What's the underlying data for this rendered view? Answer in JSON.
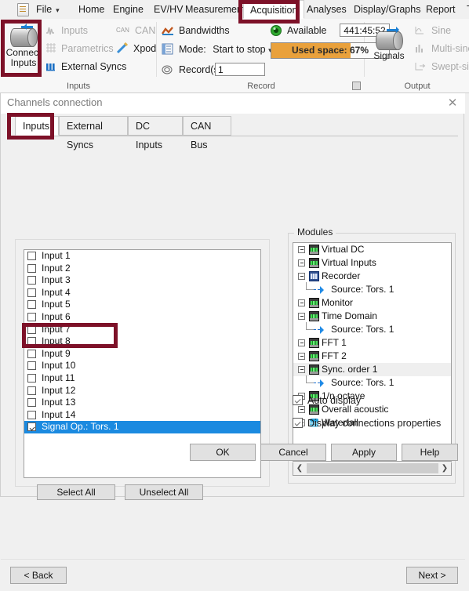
{
  "ribbon": {
    "tabs": [
      {
        "label": "File",
        "caret": true,
        "active": false
      },
      {
        "label": "Home",
        "active": false
      },
      {
        "label": "Engine",
        "active": false
      },
      {
        "label": "EV/HV",
        "active": false
      },
      {
        "label": "Measurement",
        "active": false
      },
      {
        "label": "Acquisition",
        "active": true
      },
      {
        "label": "Analyses",
        "active": false
      },
      {
        "label": "Display/Graphs",
        "active": false
      },
      {
        "label": "Report",
        "active": false
      },
      {
        "label": "T",
        "active": false
      }
    ],
    "groups": {
      "inputs": {
        "label": "Inputs",
        "big_button": {
          "line1": "Connect",
          "line2": "Inputs"
        },
        "items": [
          {
            "label": "Inputs",
            "icon": "waveform-icon",
            "disabled": true
          },
          {
            "label": "Parametrics",
            "icon": "parametrics-icon",
            "disabled": true
          },
          {
            "label": "External Syncs",
            "icon": "sync-icon",
            "disabled": false
          },
          {
            "label": "CAN",
            "icon": "can-icon",
            "disabled": true
          },
          {
            "label": "Xpod",
            "icon": "xpod-icon",
            "disabled": false
          }
        ]
      },
      "record": {
        "label": "Record",
        "bandwidths": "Bandwidths",
        "mode_label": "Mode:",
        "mode_value": "Start to stop",
        "records_label": "Record(s)",
        "records_value": "1",
        "available_label": "Available",
        "available_value": "441:45:52",
        "used_space_text": "Used space: 67%",
        "used_space_percent": 67,
        "used_space_color": "#e9a13c"
      },
      "output": {
        "label": "Output",
        "big_button": {
          "line1": "Signals",
          "line2": ""
        },
        "items": [
          {
            "label": "Sine",
            "icon": "sine-icon",
            "disabled": true
          },
          {
            "label": "Multi-sine",
            "icon": "multi-sine-icon",
            "disabled": true
          },
          {
            "label": "Swept-sine",
            "icon": "swept-sine-icon",
            "disabled": true
          }
        ]
      }
    }
  },
  "dialog": {
    "title": "Channels connection",
    "close_icon": "✕",
    "tabs": [
      {
        "label": "Inputs",
        "active": true
      },
      {
        "label": "External Syncs",
        "active": false
      },
      {
        "label": "DC Inputs",
        "active": false
      },
      {
        "label": "CAN Bus",
        "active": false
      }
    ],
    "channels": [
      {
        "label": "Input 1",
        "checked": false,
        "selected": false
      },
      {
        "label": "Input 2",
        "checked": false,
        "selected": false
      },
      {
        "label": "Input 3",
        "checked": false,
        "selected": false
      },
      {
        "label": "Input 4",
        "checked": false,
        "selected": false
      },
      {
        "label": "Input 5",
        "checked": false,
        "selected": false
      },
      {
        "label": "Input 6",
        "checked": false,
        "selected": false
      },
      {
        "label": "Input 7",
        "checked": false,
        "selected": false
      },
      {
        "label": "Input 8",
        "checked": false,
        "selected": false
      },
      {
        "label": "Input 9",
        "checked": false,
        "selected": false
      },
      {
        "label": "Input 10",
        "checked": false,
        "selected": false
      },
      {
        "label": "Input 11",
        "checked": false,
        "selected": false
      },
      {
        "label": "Input 12",
        "checked": false,
        "selected": false
      },
      {
        "label": "Input 13",
        "checked": false,
        "selected": false
      },
      {
        "label": "Input 14",
        "checked": false,
        "selected": false
      },
      {
        "label": "Signal Op.: Tors. 1",
        "checked": true,
        "selected": true
      }
    ],
    "selection_color": "#1b8ae0",
    "select_all": "Select All",
    "unselect_all": "Unselect All",
    "modules_legend": "Modules",
    "modules": [
      {
        "label": "Virtual DC",
        "icon": "scope-module-icon",
        "indent": 0,
        "expander": true,
        "highlight": false
      },
      {
        "label": "Virtual Inputs",
        "icon": "scope-module-icon",
        "indent": 0,
        "expander": true,
        "highlight": false
      },
      {
        "label": "Recorder",
        "icon": "recorder-module-icon",
        "indent": 0,
        "expander": true,
        "highlight": false
      },
      {
        "label": "Source: Tors. 1",
        "icon": "source-arrow-icon",
        "indent": 1,
        "expander": false,
        "highlight": false
      },
      {
        "label": "Monitor",
        "icon": "scope-module-icon",
        "indent": 0,
        "expander": true,
        "highlight": false
      },
      {
        "label": "Time Domain",
        "icon": "scope-module-icon",
        "indent": 0,
        "expander": true,
        "highlight": false
      },
      {
        "label": "Source: Tors. 1",
        "icon": "source-arrow-icon",
        "indent": 1,
        "expander": false,
        "highlight": false
      },
      {
        "label": "FFT 1",
        "icon": "scope-module-icon",
        "indent": 0,
        "expander": true,
        "highlight": false
      },
      {
        "label": "FFT 2",
        "icon": "scope-module-icon",
        "indent": 0,
        "expander": true,
        "highlight": false
      },
      {
        "label": "Sync. order 1",
        "icon": "scope-module-icon",
        "indent": 0,
        "expander": true,
        "highlight": true
      },
      {
        "label": "Source: Tors. 1",
        "icon": "source-arrow-icon",
        "indent": 1,
        "expander": false,
        "highlight": false
      },
      {
        "label": "1/n octave",
        "icon": "scope-module-icon",
        "indent": 0,
        "expander": true,
        "highlight": false
      },
      {
        "label": "Overall acoustic",
        "icon": "scope-module-icon",
        "indent": 0,
        "expander": true,
        "highlight": false
      },
      {
        "label": "Waterfall",
        "icon": "waterfall-module-icon",
        "indent": 0,
        "expander": true,
        "highlight": false
      }
    ],
    "scroll_left_icon": "❮",
    "scroll_right_icon": "❯",
    "auto_display": "Auto display",
    "display_conn_props": "Display connections properties",
    "buttons": {
      "ok": "OK",
      "cancel": "Cancel",
      "apply": "Apply",
      "help": "Help"
    },
    "wizard": {
      "back": "< Back",
      "next": "Next >"
    }
  },
  "annotations": {
    "color": "#7d1128"
  }
}
